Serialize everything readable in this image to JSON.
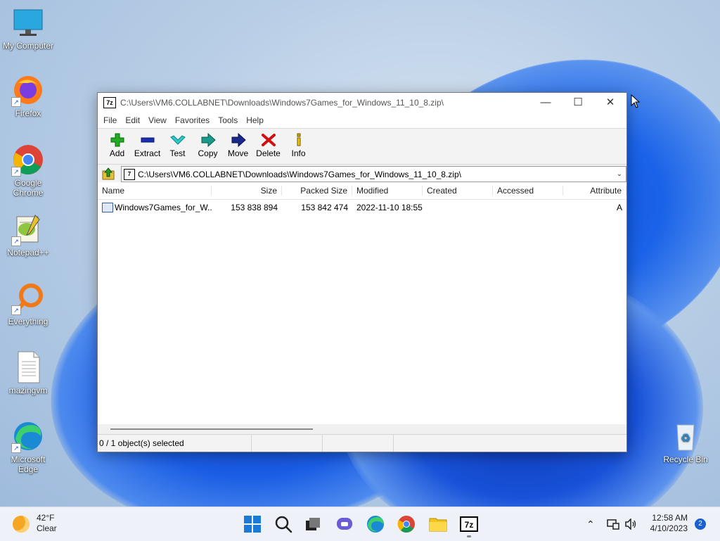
{
  "desktop": {
    "icons": [
      {
        "label": "My Computer"
      },
      {
        "label": "Firefox"
      },
      {
        "label": "Google Chrome"
      },
      {
        "label": "Notepad++"
      },
      {
        "label": "Everything"
      },
      {
        "label": "mazingvm"
      },
      {
        "label": "Microsoft Edge"
      },
      {
        "label": "Recycle Bin"
      }
    ]
  },
  "window": {
    "title": "C:\\Users\\VM6.COLLABNET\\Downloads\\Windows7Games_for_Windows_11_10_8.zip\\",
    "app_icon_text": "7z",
    "menu": [
      "File",
      "Edit",
      "View",
      "Favorites",
      "Tools",
      "Help"
    ],
    "toolbar": [
      {
        "label": "Add",
        "icon": "plus-icon",
        "color": "#22aa22"
      },
      {
        "label": "Extract",
        "icon": "minus-icon",
        "color": "#1a2fb0"
      },
      {
        "label": "Test",
        "icon": "check-icon",
        "color": "#20b8c0"
      },
      {
        "label": "Copy",
        "icon": "arrow-right-icon",
        "color": "#1a9a8a"
      },
      {
        "label": "Move",
        "icon": "arrow-right-icon",
        "color": "#1a2a8a"
      },
      {
        "label": "Delete",
        "icon": "x-icon",
        "color": "#d01010"
      },
      {
        "label": "Info",
        "icon": "info-icon",
        "color": "#c8a800"
      }
    ],
    "address": "C:\\Users\\VM6.COLLABNET\\Downloads\\Windows7Games_for_Windows_11_10_8.zip\\",
    "columns": [
      "Name",
      "Size",
      "Packed Size",
      "Modified",
      "Created",
      "Accessed",
      "Attribute"
    ],
    "rows": [
      {
        "name": "Windows7Games_for_W...",
        "size": "153 838 894",
        "packed": "153 842 474",
        "modified": "2022-11-10 18:55",
        "created": "",
        "accessed": "",
        "attr": "A"
      }
    ],
    "status": "0 / 1 object(s) selected"
  },
  "taskbar": {
    "weather_temp": "42°F",
    "weather_cond": "Clear",
    "time": "12:58 AM",
    "date": "4/10/2023",
    "notification_count": "2"
  }
}
